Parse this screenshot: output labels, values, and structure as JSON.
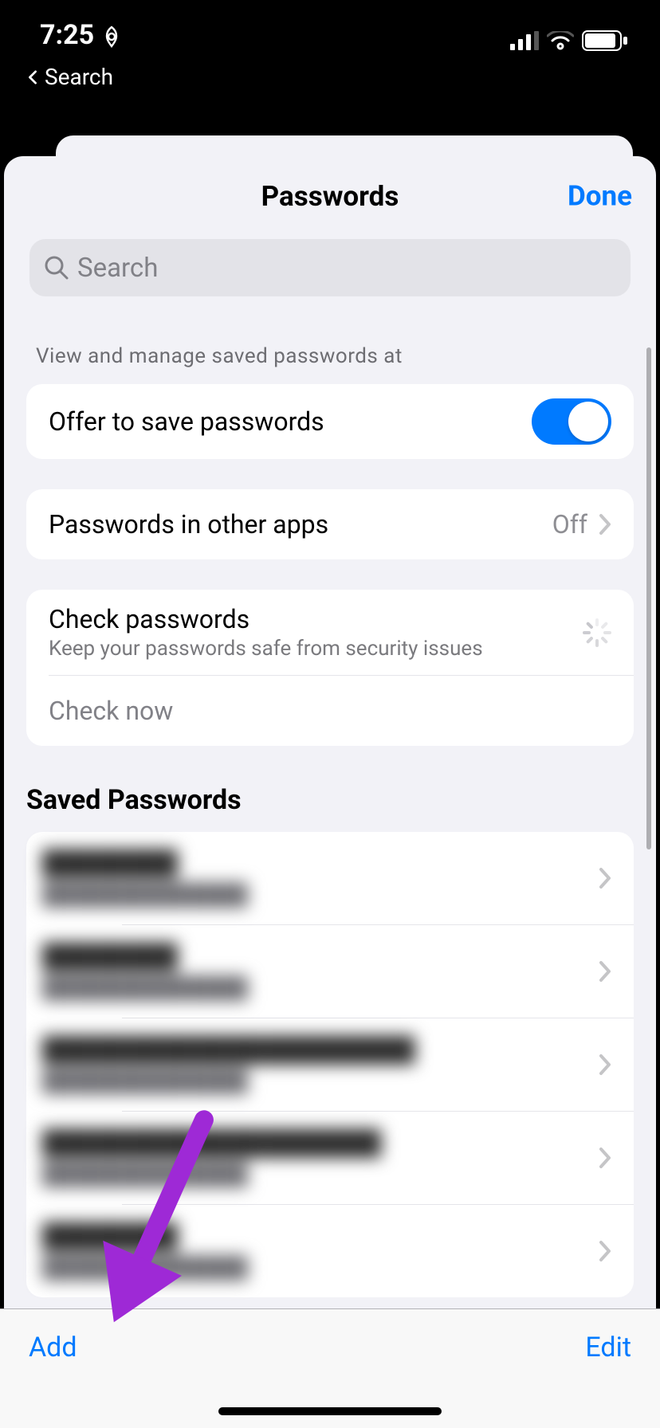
{
  "statusbar": {
    "time": "7:25",
    "back_label": "Search"
  },
  "sheet": {
    "title": "Passwords",
    "done_label": "Done",
    "search_placeholder": "Search",
    "hint_text": "View and manage saved passwords at",
    "offer_label": "Offer to save passwords",
    "offer_on": true,
    "other_apps_label": "Passwords in other apps",
    "other_apps_value": "Off",
    "check_label": "Check passwords",
    "check_sub": "Keep your passwords safe from security issues",
    "check_now_label": "Check now",
    "saved_heading": "Saved Passwords"
  },
  "saved_items": [
    {
      "title": "████████",
      "sub": "██████████████"
    },
    {
      "title": "████████",
      "sub": "██████████████"
    },
    {
      "title": "██████████████████████",
      "sub": "██████████████"
    },
    {
      "title": "████████████████████",
      "sub": "██████████████"
    },
    {
      "title": "████████",
      "sub": "██████████████"
    }
  ],
  "toolbar": {
    "add_label": "Add",
    "edit_label": "Edit"
  }
}
